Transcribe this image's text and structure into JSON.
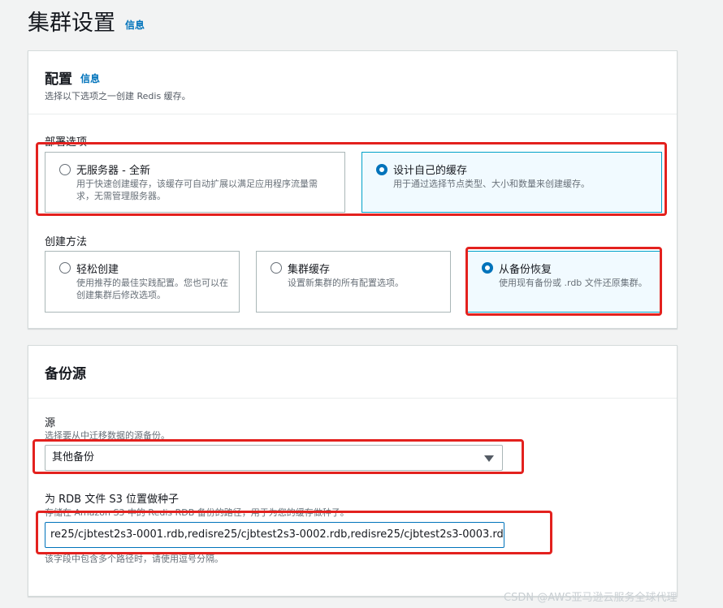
{
  "page": {
    "title": "集群设置",
    "info": "信息"
  },
  "config": {
    "title": "配置",
    "info": "信息",
    "description": "选择以下选项之一创建 Redis 缓存。",
    "deployment": {
      "label": "部署选项",
      "options": [
        {
          "label": "无服务器 - 全新",
          "description": "用于快速创建缓存，该缓存可自动扩展以满足应用程序流量需求，无需管理服务器。",
          "selected": false
        },
        {
          "label": "设计自己的缓存",
          "description": "用于通过选择节点类型、大小和数量来创建缓存。",
          "selected": true
        }
      ]
    },
    "creation": {
      "label": "创建方法",
      "options": [
        {
          "label": "轻松创建",
          "description": "使用推荐的最佳实践配置。您也可以在创建集群后修改选项。",
          "selected": false
        },
        {
          "label": "集群缓存",
          "description": "设置新集群的所有配置选项。",
          "selected": false
        },
        {
          "label": "从备份恢复",
          "description": "使用现有备份或 .rdb 文件还原集群。",
          "selected": true
        }
      ]
    }
  },
  "backup": {
    "title": "备份源",
    "source": {
      "label": "源",
      "description": "选择要从中迁移数据的源备份。",
      "value": "其他备份"
    },
    "seed": {
      "label": "为 RDB 文件 S3 位置做种子",
      "description": "存储在 Amazon S3 中的 Redis RDB 备份的路径，用于为您的缓存做种子。",
      "value": "re25/cjbtest2s3-0001.rdb,redisre25/cjbtest2s3-0002.rdb,redisre25/cjbtest2s3-0003.rd",
      "hint": "该字段中包含多个路径时，请使用逗号分隔。"
    }
  },
  "watermark": "CSDN @AWS亚马逊云服务全球代理",
  "colors": {
    "highlight_box": "#e3211e",
    "selected_border": "#00a1c9",
    "link": "#0073bb"
  }
}
